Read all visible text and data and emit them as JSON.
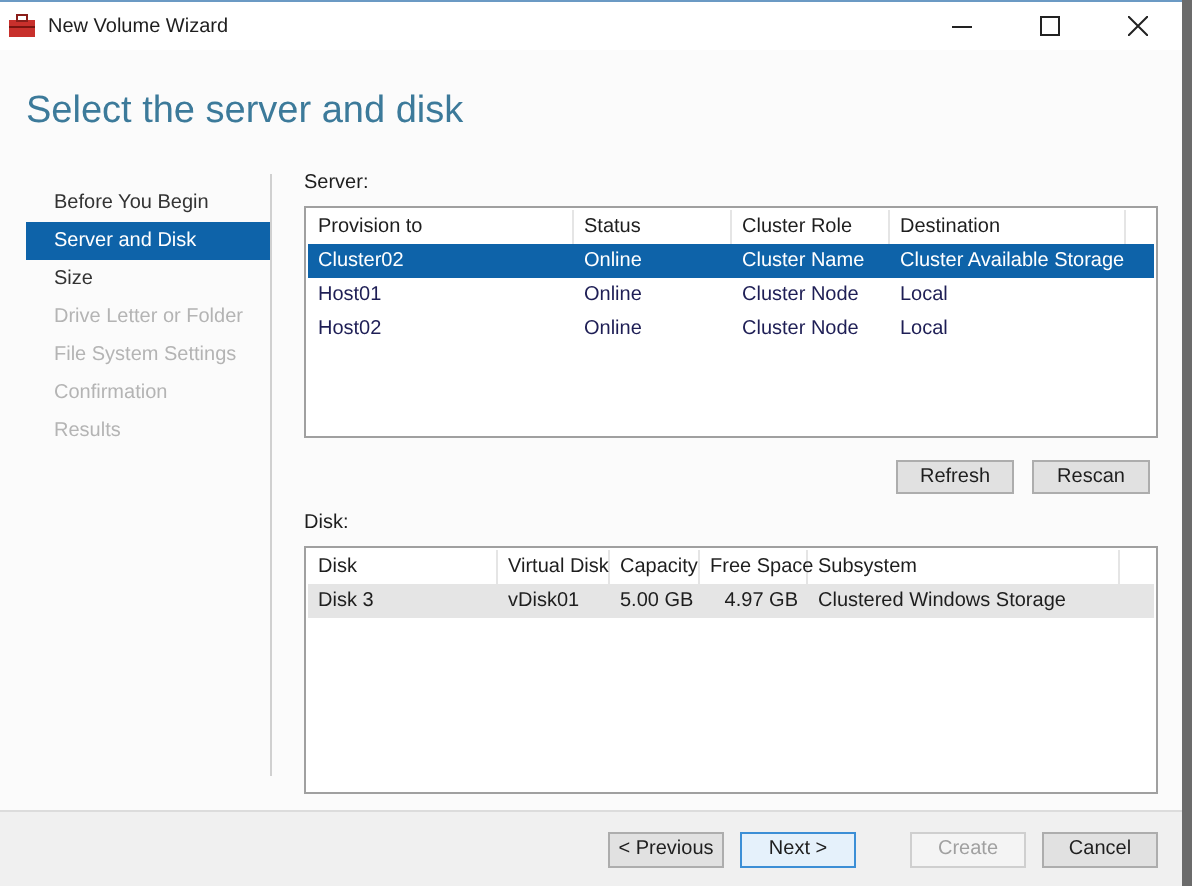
{
  "window": {
    "title": "New Volume Wizard"
  },
  "heading": "Select the server and disk",
  "steps": [
    {
      "label": "Before You Begin",
      "selected": false,
      "disabled": false
    },
    {
      "label": "Server and Disk",
      "selected": true,
      "disabled": false
    },
    {
      "label": "Size",
      "selected": false,
      "disabled": false
    },
    {
      "label": "Drive Letter or Folder",
      "selected": false,
      "disabled": true
    },
    {
      "label": "File System Settings",
      "selected": false,
      "disabled": true
    },
    {
      "label": "Confirmation",
      "selected": false,
      "disabled": true
    },
    {
      "label": "Results",
      "selected": false,
      "disabled": true
    }
  ],
  "server": {
    "label": "Server:",
    "columns": [
      "Provision to",
      "Status",
      "Cluster Role",
      "Destination"
    ],
    "rows": [
      {
        "cells": [
          "Cluster02",
          "Online",
          "Cluster Name",
          "Cluster Available Storage"
        ],
        "selected": true
      },
      {
        "cells": [
          "Host01",
          "Online",
          "Cluster Node",
          "Local"
        ],
        "selected": false
      },
      {
        "cells": [
          "Host02",
          "Online",
          "Cluster Node",
          "Local"
        ],
        "selected": false
      }
    ],
    "buttons": [
      "Refresh",
      "Rescan"
    ]
  },
  "disk": {
    "label": "Disk:",
    "columns": [
      "Disk",
      "Virtual Disk",
      "Capacity",
      "Free Space",
      "Subsystem"
    ],
    "rows": [
      {
        "cells": [
          "Disk 3",
          "vDisk01",
          "5.00 GB",
          "4.97 GB",
          "Clustered Windows Storage"
        ],
        "selected": true
      }
    ]
  },
  "footer_buttons": [
    {
      "label": "< Previous",
      "disabled": false,
      "default": false
    },
    {
      "label": "Next >",
      "disabled": false,
      "default": true
    },
    {
      "label": "Create",
      "disabled": true,
      "default": false
    },
    {
      "label": "Cancel",
      "disabled": false,
      "default": false
    }
  ]
}
